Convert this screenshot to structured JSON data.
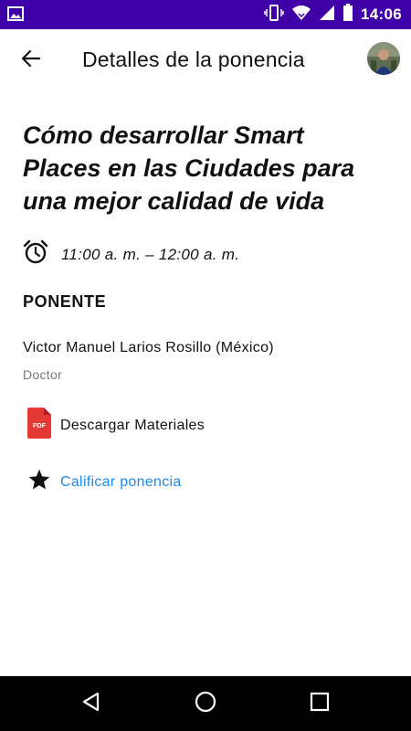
{
  "status_bar": {
    "time": "14:06",
    "icons": [
      "image-icon",
      "vibrate-icon",
      "wifi-icon",
      "signal-icon",
      "battery-icon"
    ]
  },
  "app_bar": {
    "title": "Detalles de la ponencia",
    "back_icon": "arrow-back-icon",
    "avatar": "user-avatar"
  },
  "talk": {
    "title": "Cómo desarrollar Smart Places en las Ciudades para una mejor calidad de vida",
    "time_range": "11:00 a. m. – 12:00 a. m.",
    "time_icon": "alarm-clock-icon"
  },
  "speaker_section": {
    "heading": "PONENTE",
    "name": "Victor Manuel Larios Rosillo (México)",
    "role": "Doctor"
  },
  "actions": {
    "download_label": "Descargar Materiales",
    "download_icon": "pdf-file-icon",
    "pdf_badge": "PDF",
    "rate_label": "Calificar ponencia",
    "rate_icon": "star-icon"
  },
  "nav_bar": {
    "buttons": [
      "back-triangle-icon",
      "home-circle-icon",
      "recents-square-icon"
    ]
  },
  "colors": {
    "status_bar": "#3f00a8",
    "link": "#1e88e5",
    "pdf_red": "#e53935",
    "nav_bar": "#000000"
  }
}
